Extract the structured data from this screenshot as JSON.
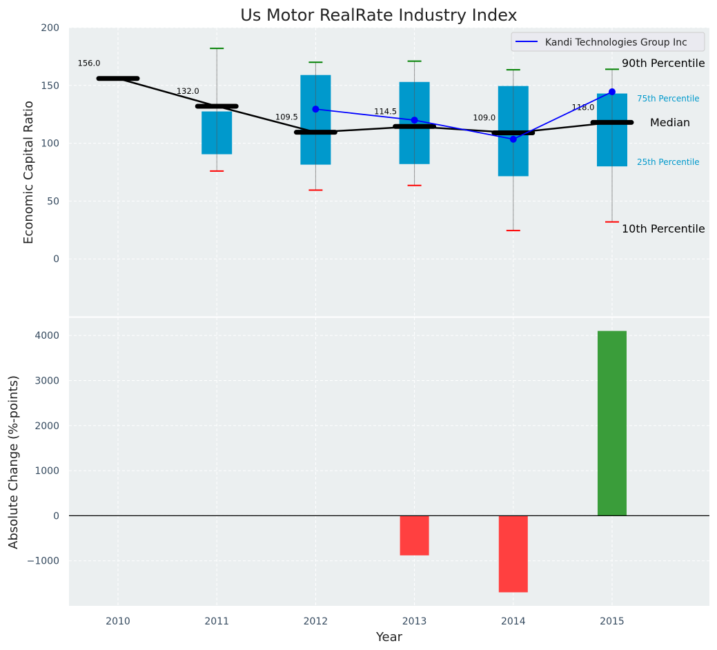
{
  "title": "Us Motor RealRate Industry Index",
  "colors": {
    "background": "#ebeff0",
    "box": "#0099cc",
    "median": "#000000",
    "company": "#0000ff",
    "whisker_high": "#008000",
    "whisker_low": "#ff0000",
    "positive": "#3a9d3a",
    "negative": "#ff4040"
  },
  "chart_data": [
    {
      "type": "box",
      "ylabel": "Economic Capital Ratio",
      "ylim": [
        -50,
        200
      ],
      "yticks": [
        0,
        50,
        100,
        150,
        200
      ],
      "grid": true,
      "legend_position": "top-right",
      "categories": [
        "2010",
        "2011",
        "2012",
        "2013",
        "2014",
        "2015"
      ],
      "median": [
        156.0,
        132.0,
        109.5,
        114.5,
        109.0,
        118.0
      ],
      "median_labels": [
        "156.0",
        "132.0",
        "109.5",
        "114.5",
        "109.0",
        "118.0"
      ],
      "p25": [
        null,
        90.5,
        81.5,
        82,
        71.5,
        80
      ],
      "p75": [
        null,
        127.5,
        159,
        153,
        149.5,
        143
      ],
      "p10": [
        null,
        76,
        59.5,
        63.5,
        24.5,
        32
      ],
      "p90": [
        null,
        182,
        170,
        171,
        163.5,
        164
      ],
      "series": [
        {
          "name": "Kandi Technologies Group Inc",
          "values": [
            null,
            null,
            129.5,
            120,
            103.5,
            144.5
          ]
        }
      ],
      "annotations": {
        "p90": "90th Percentile",
        "p75": "75th Percentile",
        "median": "Median",
        "p25": "25th Percentile",
        "p10": "10th Percentile"
      }
    },
    {
      "type": "bar",
      "xlabel": "Year",
      "ylabel": "Absolute Change (%-points)",
      "ylim": [
        -2000,
        4400
      ],
      "yticks": [
        -1000,
        0,
        1000,
        2000,
        3000,
        4000
      ],
      "ytick_labels": [
        "−1000",
        "0",
        "1000",
        "2000",
        "3000",
        "4000"
      ],
      "grid": true,
      "categories": [
        "2010",
        "2011",
        "2012",
        "2013",
        "2014",
        "2015"
      ],
      "values": [
        null,
        null,
        null,
        -880,
        -1700,
        4100
      ]
    }
  ]
}
